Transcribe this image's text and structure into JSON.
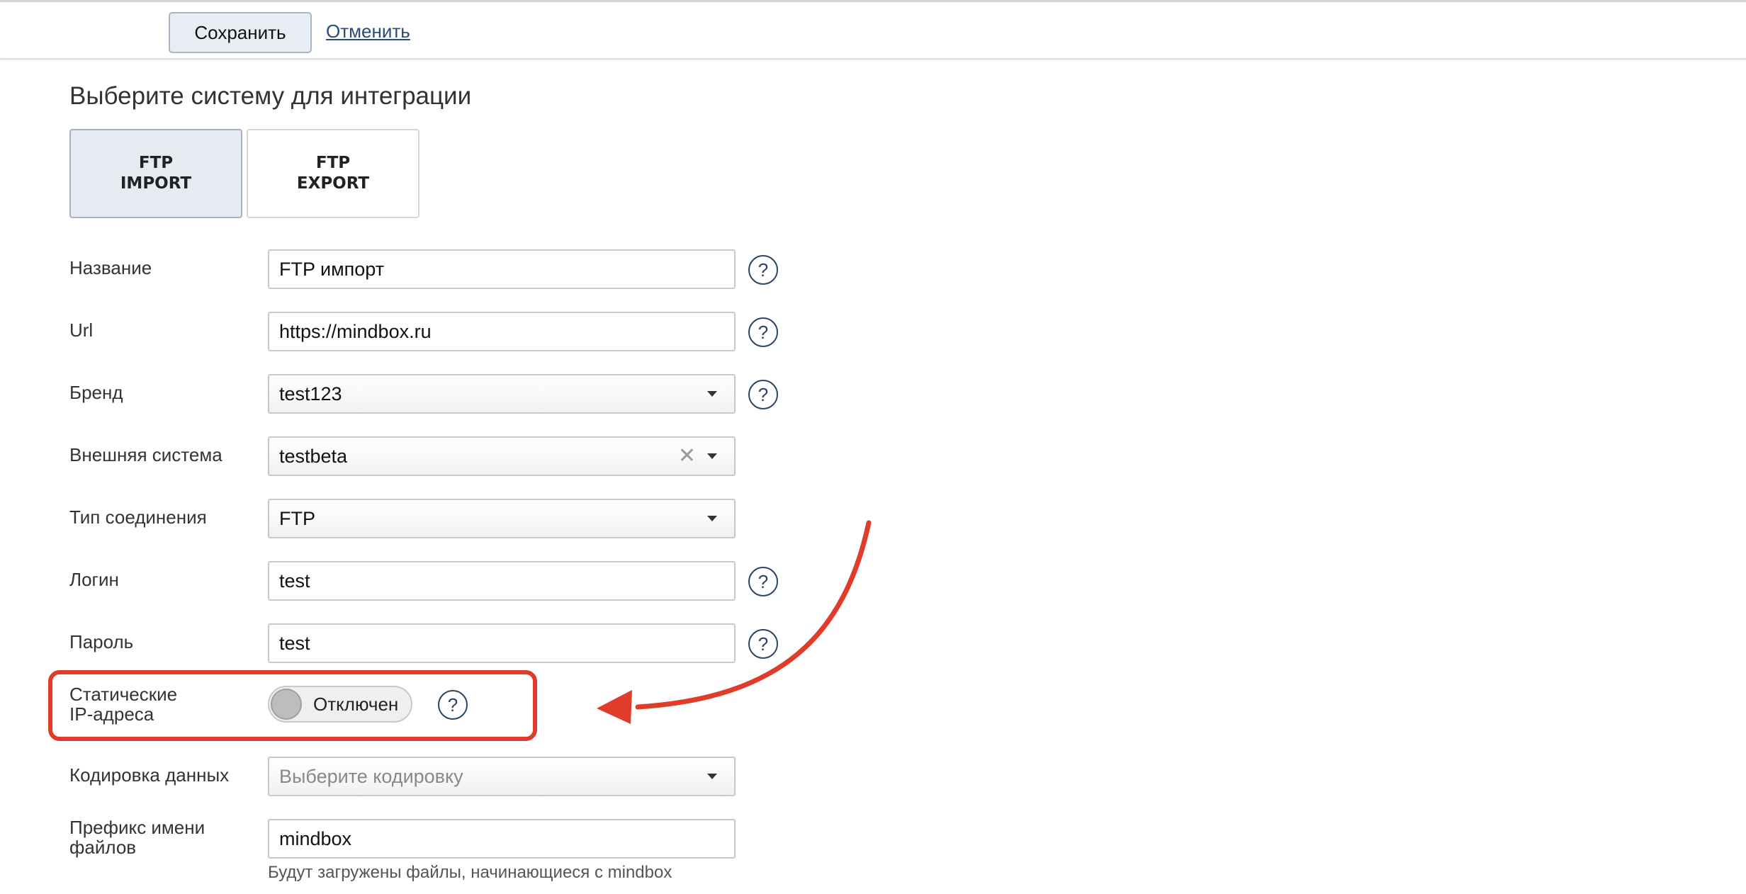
{
  "toolbar": {
    "save_label": "Сохранить",
    "cancel_label": "Отменить"
  },
  "section_title": "Выберите систему для интеграции",
  "integration_tiles": [
    {
      "line1": "FTP",
      "line2": "IMPORT",
      "selected": true
    },
    {
      "line1": "FTP",
      "line2": "EXPORT",
      "selected": false
    }
  ],
  "form": {
    "name": {
      "label": "Название",
      "value": "FTP импорт"
    },
    "url": {
      "label": "Url",
      "value": "https://mindbox.ru"
    },
    "brand": {
      "label": "Бренд",
      "value": "test123"
    },
    "external": {
      "label": "Внешняя система",
      "value": "testbeta"
    },
    "connection": {
      "label": "Тип соединения",
      "value": "FTP"
    },
    "login": {
      "label": "Логин",
      "value": "test"
    },
    "password": {
      "label": "Пароль",
      "value": "test"
    },
    "static_ip": {
      "label_line1": "Статические",
      "label_line2": "IP-адреса",
      "state": "Отключен"
    },
    "encoding": {
      "label": "Кодировка данных",
      "placeholder": "Выберите кодировку"
    },
    "prefix": {
      "label_line1": "Префикс имени",
      "label_line2": "файлов",
      "value": "mindbox",
      "hint": "Будут загружены файлы, начинающиеся с mindbox"
    }
  },
  "help_glyph": "?",
  "clear_glyph": "✕",
  "colors": {
    "annotation": "#e03c2b",
    "help_icon": "#2a4466",
    "link": "#2a4a78"
  }
}
